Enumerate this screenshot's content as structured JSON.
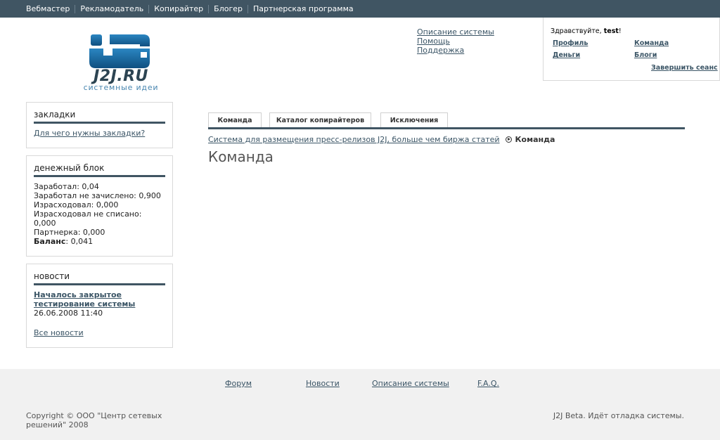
{
  "topnav": [
    "Вебмастер",
    "Рекламодатель",
    "Копирайтер",
    "Блогер",
    "Партнерская программа"
  ],
  "logo": {
    "text": "J2J.RU",
    "sub": "системные идеи"
  },
  "header_links": [
    "Описание системы",
    "Помощь",
    "Поддержка"
  ],
  "userbox": {
    "greeting": "Здравствуйте,",
    "username": "test",
    "exclaim": "!",
    "profile": "Профиль",
    "team": "Команда",
    "money": "Деньги",
    "blogs": "Блоги",
    "logout": "Завершить сеанс"
  },
  "bookmarks": {
    "title": "закладки",
    "link": "Для чего нужны закладки?"
  },
  "money_block": {
    "title": "денежный блок",
    "lines": [
      "Заработал: 0,04",
      "Заработал не зачислено: 0,900",
      "Израсходовал: 0,000",
      "Израсходовал не списано: 0,000",
      "Партнерка: 0,000"
    ],
    "balance_label": "Баланс",
    "balance_value": ": 0,041"
  },
  "news": {
    "title": "новости",
    "item_title_1": "Началось закрытое",
    "item_title_2": "тестирование системы",
    "item_date": "26.06.2008 11:40",
    "all": "Все новости"
  },
  "tabs": [
    "Команда",
    "Каталог копирайтеров",
    "Исключения"
  ],
  "breadcrumb": {
    "link": "Система для размещения пресс-релизов J2J, больше чем биржа статей",
    "current": "Команда"
  },
  "page_title": "Команда",
  "footer": {
    "links": [
      "Форум",
      "Новости",
      "Описание системы",
      "F.A.Q."
    ],
    "copyright": "Copyright © ООО \"Центр сетевых решений\" 2008",
    "beta": "J2J Beta. Идёт отладка системы."
  },
  "colors": {
    "nav_bg": "#405563",
    "accent": "#405563",
    "link": "#3b5566",
    "logo_blue": "#1f6fa6"
  }
}
